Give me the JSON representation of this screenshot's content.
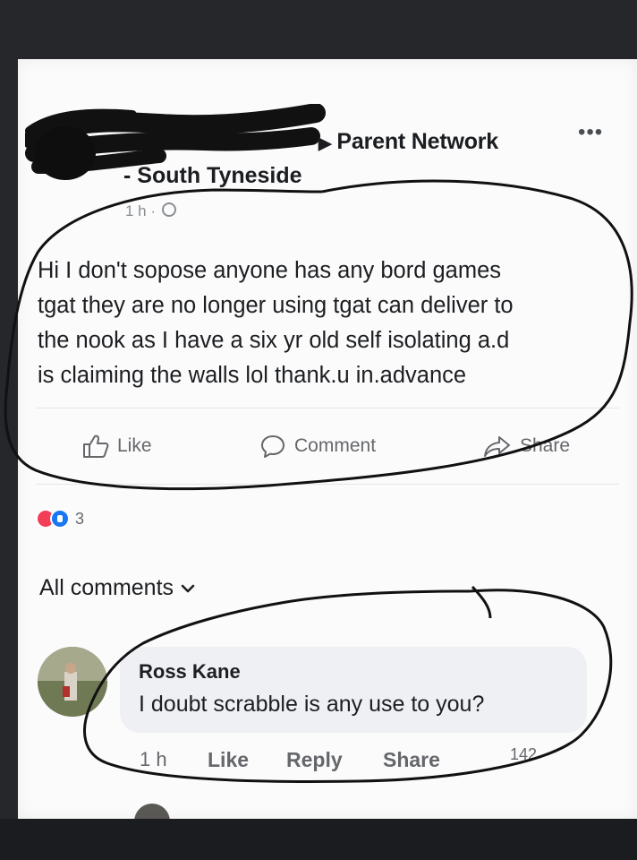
{
  "post": {
    "group_name": "Parent Network",
    "subgroup": "- South Tyneside",
    "time": "1 h ·",
    "text_lines": [
      "Hi I don't sopose anyone has any bord games",
      "tgat they are no longer using tgat can deliver to",
      "the nook as I have a six yr old self isolating a.d",
      "is claiming the walls lol  thank.u in.advance"
    ],
    "actions": {
      "like": "Like",
      "comment": "Comment",
      "share": "Share"
    },
    "reaction_count": "3",
    "more_icon": "•••"
  },
  "comments_section": {
    "filter_label": "All comments"
  },
  "comment": {
    "author": "Ross Kane",
    "text": "I doubt scrabble is any use to you?",
    "time": "1 h",
    "like": "Like",
    "reply": "Reply",
    "share": "Share",
    "reaction_count": "142"
  },
  "icons": {
    "thumbs_up": "thumbs-up-icon",
    "comment": "comment-bubble-icon",
    "share": "share-arrow-icon",
    "globe": "globe-icon",
    "chevron": "chevron-down-icon",
    "love_reaction": "love-reaction-icon",
    "like_reaction": "like-reaction-icon"
  },
  "colors": {
    "text": "#1c1e21",
    "muted": "#65676b",
    "love": "#f33e58",
    "like": "#1877f2",
    "bubble": "#eff0f3"
  }
}
